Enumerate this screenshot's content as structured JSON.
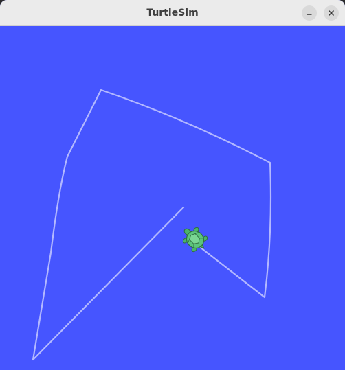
{
  "window": {
    "title": "TurtleSim"
  },
  "titlebar": {
    "buttons": [
      {
        "name": "minimize",
        "icon": "minimize-icon"
      },
      {
        "name": "close",
        "icon": "close-icon"
      }
    ]
  },
  "canvas": {
    "background_color": "#4655ff",
    "pen_color": "#b3b8ff",
    "turtle_icon": "turtle-icon",
    "turtle_color": "#4cb36a"
  }
}
